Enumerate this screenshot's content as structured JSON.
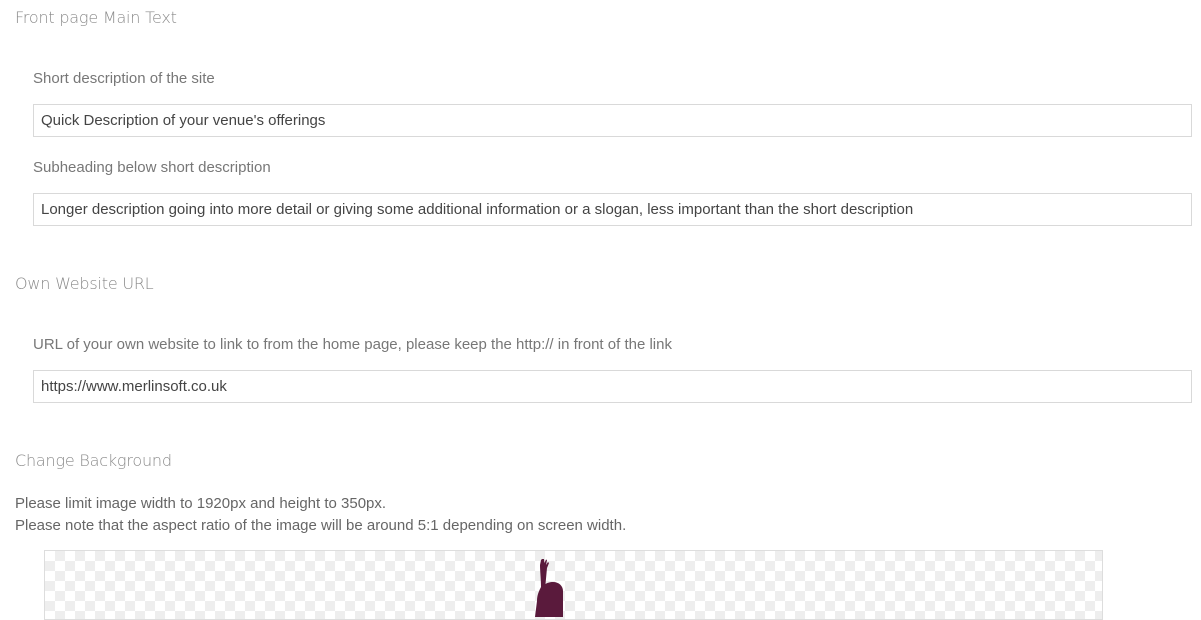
{
  "front_page": {
    "title": "Front page Main Text",
    "short_description": {
      "label": "Short description of the site",
      "value": "Quick Description of your venue's offerings"
    },
    "subheading": {
      "label": "Subheading below short description",
      "value": "Longer description going into more detail or giving some additional information or a slogan, less important than the short description"
    }
  },
  "website": {
    "title": "Own Website URL",
    "url_field": {
      "label": "URL of your own website to link to from the home page, please keep the http:// in front of the link",
      "value": "https://www.merlinsoft.co.uk"
    }
  },
  "background": {
    "title": "Change Background",
    "note_1": "Please limit image width to 1920px and height to 350px.",
    "note_2": "Please note that the aspect ratio of the image will be around 5:1 depending on screen width.",
    "figure_color": "#5a1a3c"
  }
}
